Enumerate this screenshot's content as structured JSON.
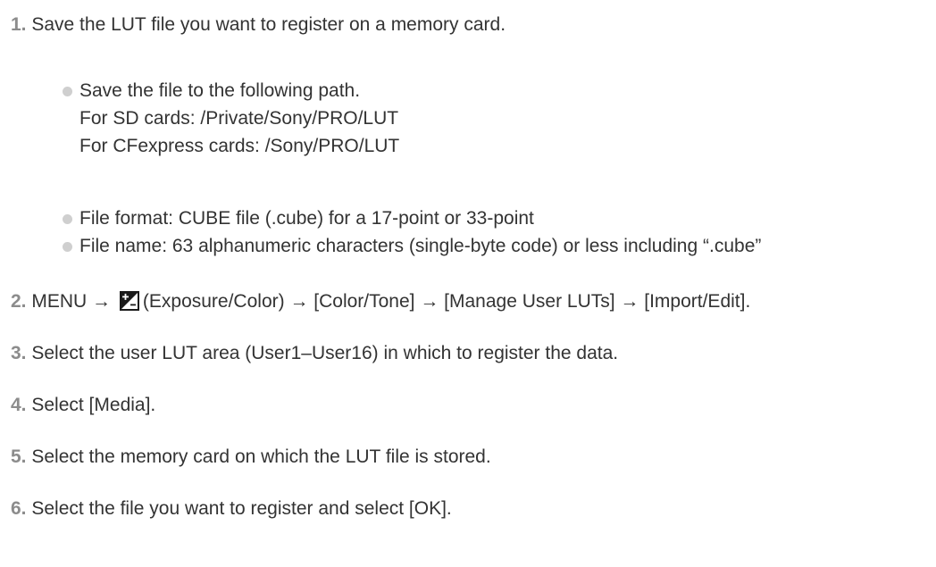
{
  "steps": [
    {
      "number": "1.",
      "text": "Save the LUT file you want to register on a memory card."
    },
    {
      "number": "2.",
      "parts": {
        "menu": "MENU",
        "arrow": "→",
        "rest": "(Exposure/Color) → [Color/Tone] → [Manage User LUTs] → [Import/Edit]."
      },
      "icon": "exposure-color-icon"
    },
    {
      "number": "3.",
      "text": "Select the user LUT area (User1–User16) in which to register the data."
    },
    {
      "number": "4.",
      "text": "Select [Media]."
    },
    {
      "number": "5.",
      "text": "Select the memory card on which the LUT file is stored."
    },
    {
      "number": "6.",
      "text": "Select the file you want to register and select [OK]."
    }
  ],
  "step1_bullets": [
    {
      "lines": [
        "Save the file to the following path.",
        "For SD cards: /Private/Sony/PRO/LUT",
        "For CFexpress cards: /Sony/PRO/LUT"
      ]
    },
    {
      "lines": [
        "File format: CUBE file (.cube) for a 17-point or 33-point"
      ]
    },
    {
      "lines": [
        "File name: 63 alphanumeric characters (single-byte code) or less including “.cube”"
      ]
    }
  ],
  "colors": {
    "step_number": "#8c8c8c",
    "text": "#333333",
    "bullet": "#cfcfcf",
    "icon_bg": "#1a1a1a"
  }
}
